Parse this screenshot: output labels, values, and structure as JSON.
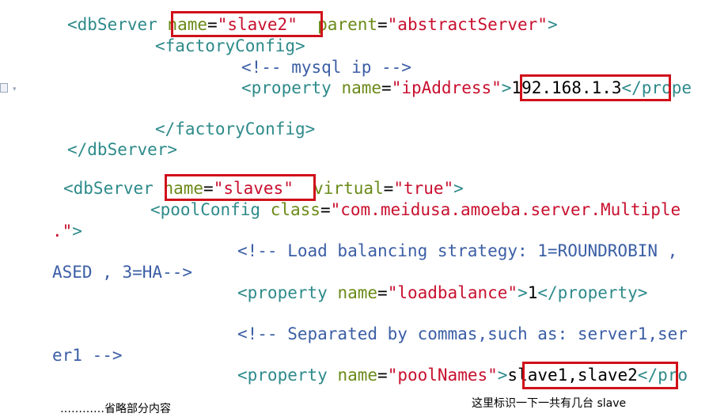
{
  "code": {
    "l1": {
      "tag_open": "<dbServer",
      "attr1": "name",
      "val1": "\"slave2\"",
      "attr2": "parent",
      "val2": "\"abstractServer\"",
      "close": ">"
    },
    "l2": {
      "tag": "<factoryConfig>"
    },
    "l3": {
      "comment": "<!-- mysql ip -->"
    },
    "l4": {
      "tag_open": "<property",
      "attr": "name",
      "val": "\"ipAddress\"",
      "close": ">",
      "text": "192.168.1.3",
      "end": "</prope"
    },
    "l5": {
      "tag": "</factoryConfig>"
    },
    "l6": {
      "tag": "</dbServer>"
    },
    "l7": {
      "tag_open": "<dbServer",
      "attr1": "name",
      "val1": "\"slaves\"",
      "attr2": "virtual",
      "val2": "\"true\"",
      "close": ">"
    },
    "l8": {
      "tag_open": "<poolConfig",
      "attr": "class",
      "val": "\"com.meidusa.amoeba.server.Multiple"
    },
    "l9": {
      "val_tail": ".\"",
      "close": ">"
    },
    "l10": {
      "comment": "<!-- Load balancing strategy: 1=ROUNDROBIN ,"
    },
    "l11": {
      "comment": "ASED , 3=HA-->"
    },
    "l12": {
      "tag_open": "<property",
      "attr": "name",
      "val": "\"loadbalance\"",
      "close": ">",
      "text": "1",
      "end": "</property>"
    },
    "l13": {
      "comment": "<!-- Separated by commas,such as: server1,ser"
    },
    "l14": {
      "comment": "er1 -->"
    },
    "l15": {
      "tag_open": "<property",
      "attr": "name",
      "val": "\"poolNames\"",
      "close": ">",
      "text": "slave1,slave2",
      "end": "</pro"
    }
  },
  "notes": {
    "omitted": "…………省略部分内容",
    "annotation": "这里标识一下一共有几台 slave"
  },
  "colors": {
    "tag": "#2e8a8a",
    "attribute": "#6a8a18",
    "value": "#c8102e",
    "comment": "#3b5ea5",
    "highlight_box": "#d0101a"
  }
}
